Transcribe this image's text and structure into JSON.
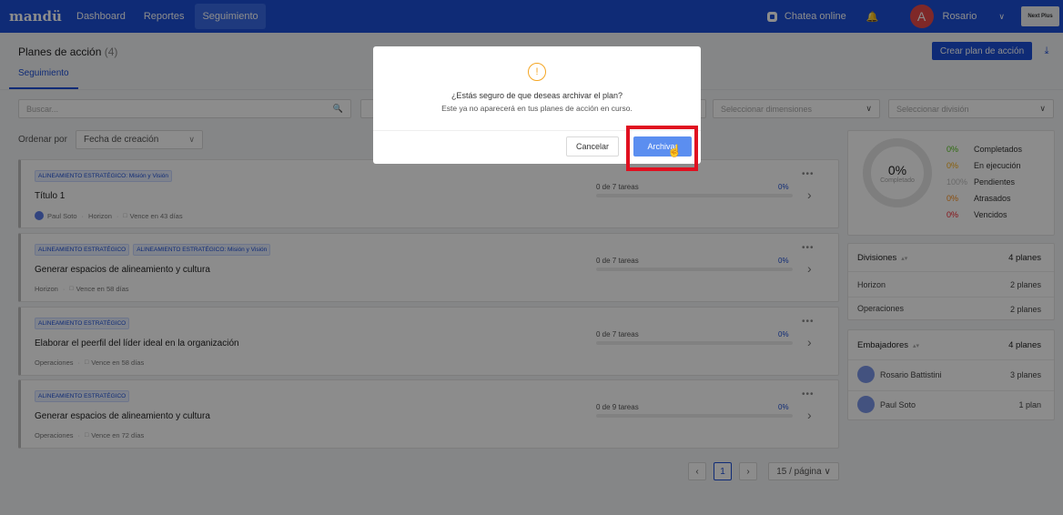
{
  "nav": {
    "logo": "mandü",
    "items": [
      "Dashboard",
      "Reportes",
      "Seguimiento"
    ],
    "chat_label": "Chatea online",
    "user_initial": "A",
    "user_name": "Rosario",
    "next_plus": "Next Plus"
  },
  "header": {
    "title": "Planes de acción",
    "count": "(4)",
    "tab": "Seguimiento",
    "create_button": "Crear plan de acción"
  },
  "filters": {
    "search_placeholder": "Buscar...",
    "dimensions_placeholder": "Seleccionar dimensiones",
    "division_placeholder": "Seleccionar división"
  },
  "order": {
    "label": "Ordenar por",
    "value": "Fecha de creación"
  },
  "plans": [
    {
      "tags": [
        "ALINEAMIENTO ESTRATÉGICO: Misión y Visión"
      ],
      "title": "Título 1",
      "owner": "Paul Soto",
      "division": "Horizon",
      "due": "Vence en 43 días",
      "tasks": "0 de 7 tareas",
      "percent": "0%"
    },
    {
      "tags": [
        "ALINEAMIENTO ESTRATÉGICO",
        "ALINEAMIENTO ESTRATÉGICO: Misión y Visión"
      ],
      "title": "Generar espacios de alineamiento y cultura",
      "division": "Horizon",
      "due": "Vence en 58 días",
      "tasks": "0 de 7 tareas",
      "percent": "0%"
    },
    {
      "tags": [
        "ALINEAMIENTO ESTRATÉGICO"
      ],
      "title": "Elaborar el peerfil del líder ideal en la organización",
      "division": "Operaciones",
      "due": "Vence en 58 días",
      "tasks": "0 de 7 tareas",
      "percent": "0%"
    },
    {
      "tags": [
        "ALINEAMIENTO ESTRATÉGICO"
      ],
      "title": "Generar espacios de alineamiento y cultura",
      "division": "Operaciones",
      "due": "Vence en 72 días",
      "tasks": "0 de 9 tareas",
      "percent": "0%"
    }
  ],
  "summary": {
    "percent": "0%",
    "label": "Completado",
    "legend": [
      {
        "pct": "0%",
        "label": "Completados",
        "color": "#52c41a"
      },
      {
        "pct": "0%",
        "label": "En ejecución",
        "color": "#faad14"
      },
      {
        "pct": "100%",
        "label": "Pendientes",
        "color": "#bfbfbf"
      },
      {
        "pct": "0%",
        "label": "Atrasados",
        "color": "#fa8c16"
      },
      {
        "pct": "0%",
        "label": "Vencidos",
        "color": "#f5222d"
      }
    ]
  },
  "divisions": {
    "header": "Divisiones",
    "total": "4 planes",
    "rows": [
      {
        "name": "Horizon",
        "count": "2 planes"
      },
      {
        "name": "Operaciones",
        "count": "2 planes"
      }
    ]
  },
  "ambassadors": {
    "header": "Embajadores",
    "total": "4 planes",
    "rows": [
      {
        "name": "Rosario Battistini",
        "count": "3 planes"
      },
      {
        "name": "Paul Soto",
        "count": "1 plan"
      }
    ]
  },
  "pagination": {
    "current": "1",
    "page_size": "15 / página"
  },
  "modal": {
    "title": "¿Estás seguro de que deseas archivar el plan?",
    "subtitle": "Este ya no aparecerá en tus planes de acción en curso.",
    "cancel": "Cancelar",
    "confirm": "Archivar"
  }
}
